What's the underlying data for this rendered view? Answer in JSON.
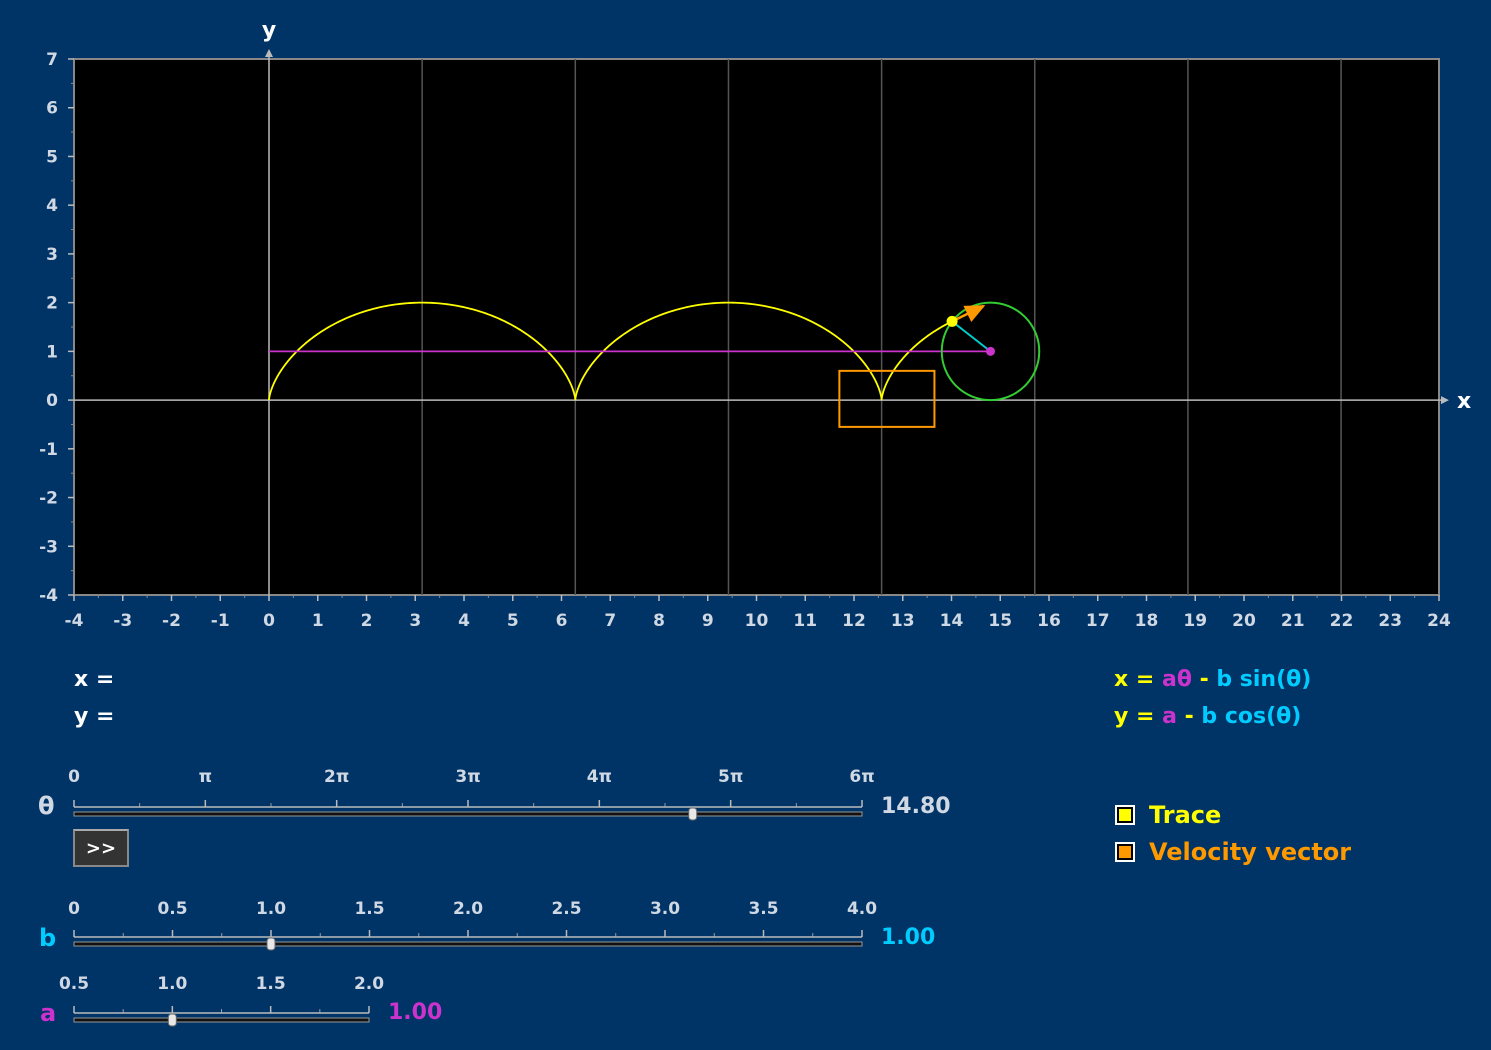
{
  "colors": {
    "background": "#003366",
    "plot_bg": "#000000",
    "curve": "#ffff00",
    "circle": "#33cc33",
    "radius": "#00cccc",
    "hline": "#cc33cc",
    "velocity": "#ff9900",
    "param_a": "#cc33cc",
    "param_b": "#00ccff",
    "axis_text": "#cfd8e3"
  },
  "axes": {
    "x_label": "x",
    "y_label": "y",
    "x_range": [
      -4,
      24
    ],
    "y_range": [
      -4,
      7
    ]
  },
  "readout": {
    "x_label": "x =",
    "y_label": "y ="
  },
  "formula": {
    "line1": {
      "lhs": "x",
      "eq": " = ",
      "a": "aθ",
      "op": " - ",
      "b": "b sin(θ)"
    },
    "line2": {
      "lhs": "y",
      "eq": " = ",
      "a": "a",
      "op": " - ",
      "b": "b cos(θ)"
    }
  },
  "sliders": {
    "theta": {
      "symbol": "θ",
      "value": 14.8,
      "value_text": "14.80",
      "min": 0,
      "max": 18.8496,
      "ticks": [
        "0",
        "π",
        "2π",
        "3π",
        "4π",
        "5π",
        "6π"
      ]
    },
    "b": {
      "symbol": "b",
      "value": 1.0,
      "value_text": "1.00",
      "min": 0,
      "max": 4,
      "ticks": [
        "0",
        "0.5",
        "1.0",
        "1.5",
        "2.0",
        "2.5",
        "3.0",
        "3.5",
        "4.0"
      ]
    },
    "a": {
      "symbol": "a",
      "value": 1.0,
      "value_text": "1.00",
      "min": 0.5,
      "max": 2.0,
      "ticks": [
        "0.5",
        "1.0",
        "1.5",
        "2.0"
      ]
    }
  },
  "play_button": {
    "label": ">>"
  },
  "checkboxes": [
    {
      "label": "Trace",
      "checked": true,
      "color": "#ffff00"
    },
    {
      "label": "Velocity vector",
      "checked": true,
      "color": "#ff9900"
    }
  ]
}
